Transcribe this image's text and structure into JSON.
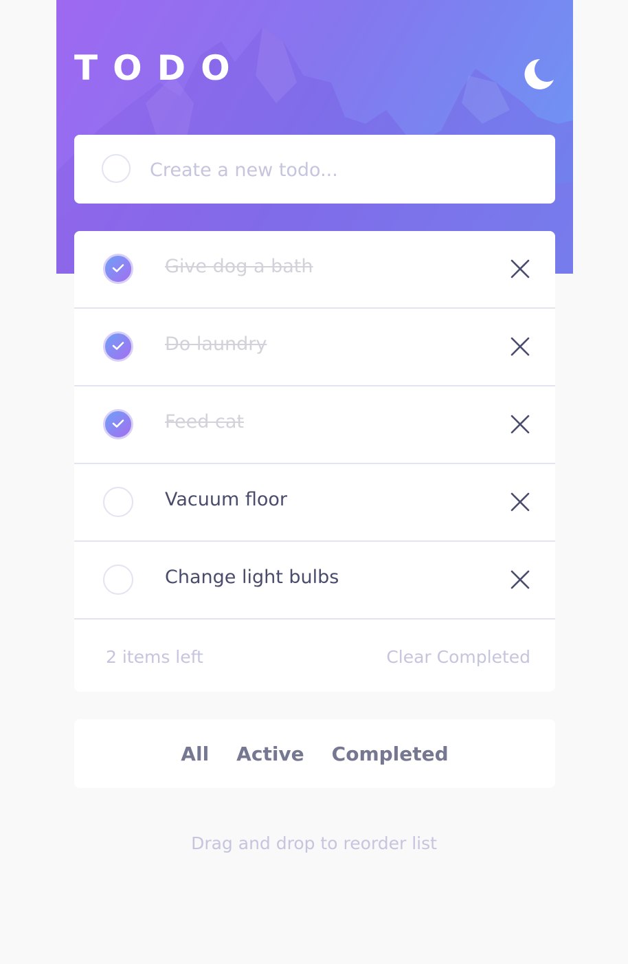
{
  "header": {
    "title": "TODO",
    "theme_icon": "moon-icon"
  },
  "new_todo": {
    "placeholder": "Create a new todo..."
  },
  "todos": [
    {
      "label": "Give dog a bath",
      "completed": true
    },
    {
      "label": "Do laundry",
      "completed": true
    },
    {
      "label": "Feed cat",
      "completed": true
    },
    {
      "label": "Vacuum floor",
      "completed": false
    },
    {
      "label": "Change light bulbs",
      "completed": false
    }
  ],
  "footer": {
    "items_left": "2 items left",
    "clear_label": "Clear Completed"
  },
  "filters": {
    "all": "All",
    "active": "Active",
    "completed": "Completed"
  },
  "hint": "Drag and drop to reorder list",
  "colors": {
    "gradient_start": "#6fa0f6",
    "gradient_end": "#a46ef0",
    "text": "#494c6b",
    "muted": "#c5c5de",
    "completed_text": "#d1d2da"
  }
}
